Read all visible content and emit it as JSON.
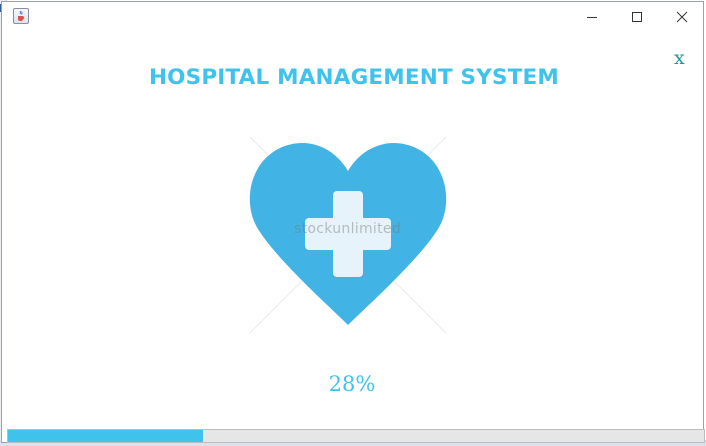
{
  "window": {
    "title": "",
    "icon": "java-cup-icon",
    "controls": [
      "minimize-icon",
      "maximize-icon",
      "close-icon"
    ]
  },
  "splash": {
    "title": "HOSPITAL MANAGEMENT SYSTEM",
    "close_label": "x",
    "logo": "heart-cross-icon",
    "watermark": "stockunlimited",
    "percent_text": "28%",
    "progress": 0.28
  },
  "colors": {
    "accent": "#3ec3ec",
    "heart": "#42b3e5",
    "cross": "#e6f3fa",
    "close_x": "#1f9a9a",
    "progress_fill": "#3fc3ec"
  }
}
